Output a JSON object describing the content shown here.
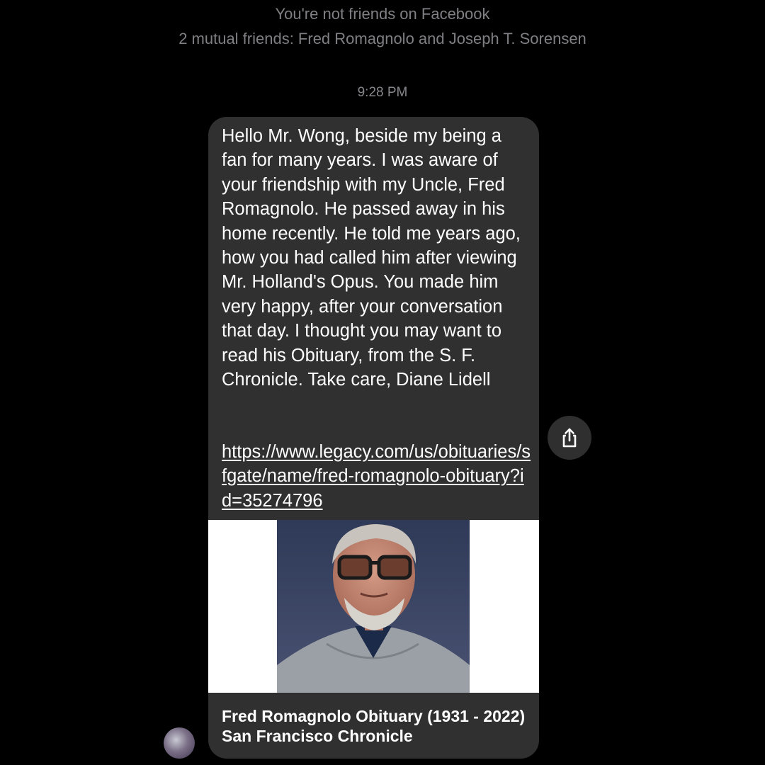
{
  "header": {
    "not_friends": "You're not friends on Facebook",
    "mutual_friends": "2 mutual friends: Fred Romagnolo and Joseph T. Sorensen",
    "timestamp": "9:28 PM"
  },
  "message": {
    "text": "Hello Mr. Wong, beside my being a fan for many years. I was aware of your friendship with my Uncle, Fred Romagnolo. He passed away in his home recently. He told me years ago, how you had called him after viewing Mr. Holland's Opus. You made him very happy, after your conversation that day. I thought you may want to read his Obituary, from the S. F. Chronicle. Take care, Diane Lidell",
    "link": "https://www.legacy.com/us/obituaries/sfgate/name/fred-romagnolo-obituary?id=35274796",
    "preview_title": "Fred Romagnolo Obituary (1931 - 2022) San Francisco Chronicle"
  },
  "icons": {
    "share": "share-icon"
  },
  "colors": {
    "background": "#000000",
    "bubble": "#303030",
    "meta_text": "#7f7f84",
    "message_text": "#ffffff"
  }
}
